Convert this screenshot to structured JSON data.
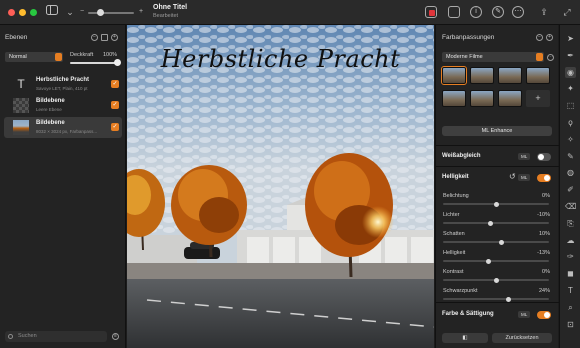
{
  "window": {
    "title": "Ohne Titel",
    "subtitle": "Bearbeitet"
  },
  "titlebar_icons": [
    "sidebar-toggle-icon",
    "chevron-down-icon",
    "zoom-slider",
    "color-swatch-icon",
    "photo-icon",
    "info-icon",
    "brush-icon",
    "more-icon",
    "share-icon",
    "fullscreen-icon"
  ],
  "left_panel": {
    "title": "Ebenen",
    "blend_mode": "Normal",
    "opacity_label": "Deckkraft",
    "opacity_value": "100%",
    "opacity": 1.0,
    "layers": [
      {
        "name": "Herbstliche Pracht",
        "sub": "Savoye LET, Plain, 410 pt",
        "type": "text",
        "visible": true,
        "selected": false
      },
      {
        "name": "Bildebene",
        "sub": "Leere Ebene",
        "type": "empty",
        "visible": true,
        "selected": false
      },
      {
        "name": "Bildebene",
        "sub": "8032 × 3024 px, Farbanpass...",
        "type": "image",
        "visible": true,
        "selected": true
      }
    ],
    "search_placeholder": "Suchen"
  },
  "canvas": {
    "title_text": "Herbstliche Pracht"
  },
  "right_panel": {
    "title": "Farbanpassungen",
    "preset": "Moderne Filme",
    "enhance_label": "ML Enhance",
    "ml_badge": "ML",
    "sections": {
      "white_balance": {
        "label": "Weißabgleich",
        "enabled": false
      },
      "brightness": {
        "label": "Helligkeit",
        "enabled": true
      },
      "color_saturation": {
        "label": "Farbe & Sättigung",
        "enabled": true
      }
    },
    "adjustments": [
      {
        "label": "Belichtung",
        "value": "0%",
        "level": 0.5
      },
      {
        "label": "Lichter",
        "value": "-10%",
        "level": 0.45
      },
      {
        "label": "Schatten",
        "value": "10%",
        "level": 0.55
      },
      {
        "label": "Helligkeit",
        "value": "-13%",
        "level": 0.43
      },
      {
        "label": "Kontrast",
        "value": "0%",
        "level": 0.5
      },
      {
        "label": "Schwarzpunkt",
        "value": "24%",
        "level": 0.62
      }
    ],
    "compare_label": "",
    "reset_label": "Zurücksetzen"
  },
  "tools": [
    "move-tool-icon",
    "pen-tool-icon",
    "adjust-tool-icon",
    "magic-tool-icon",
    "select-tool-icon",
    "lasso-tool-icon",
    "wand-tool-icon",
    "brush-tool-icon",
    "bucket-tool-icon",
    "pencil-tool-icon",
    "eraser-tool-icon",
    "clone-tool-icon",
    "smudge-tool-icon",
    "vector-pen-icon",
    "shape-tool-icon",
    "text-tool-icon",
    "zoom-tool-icon",
    "crop-tool-icon"
  ],
  "colors": {
    "accent": "#e67e22",
    "panel_bg": "#232323",
    "titlebar_bg": "#2a2a2a"
  }
}
